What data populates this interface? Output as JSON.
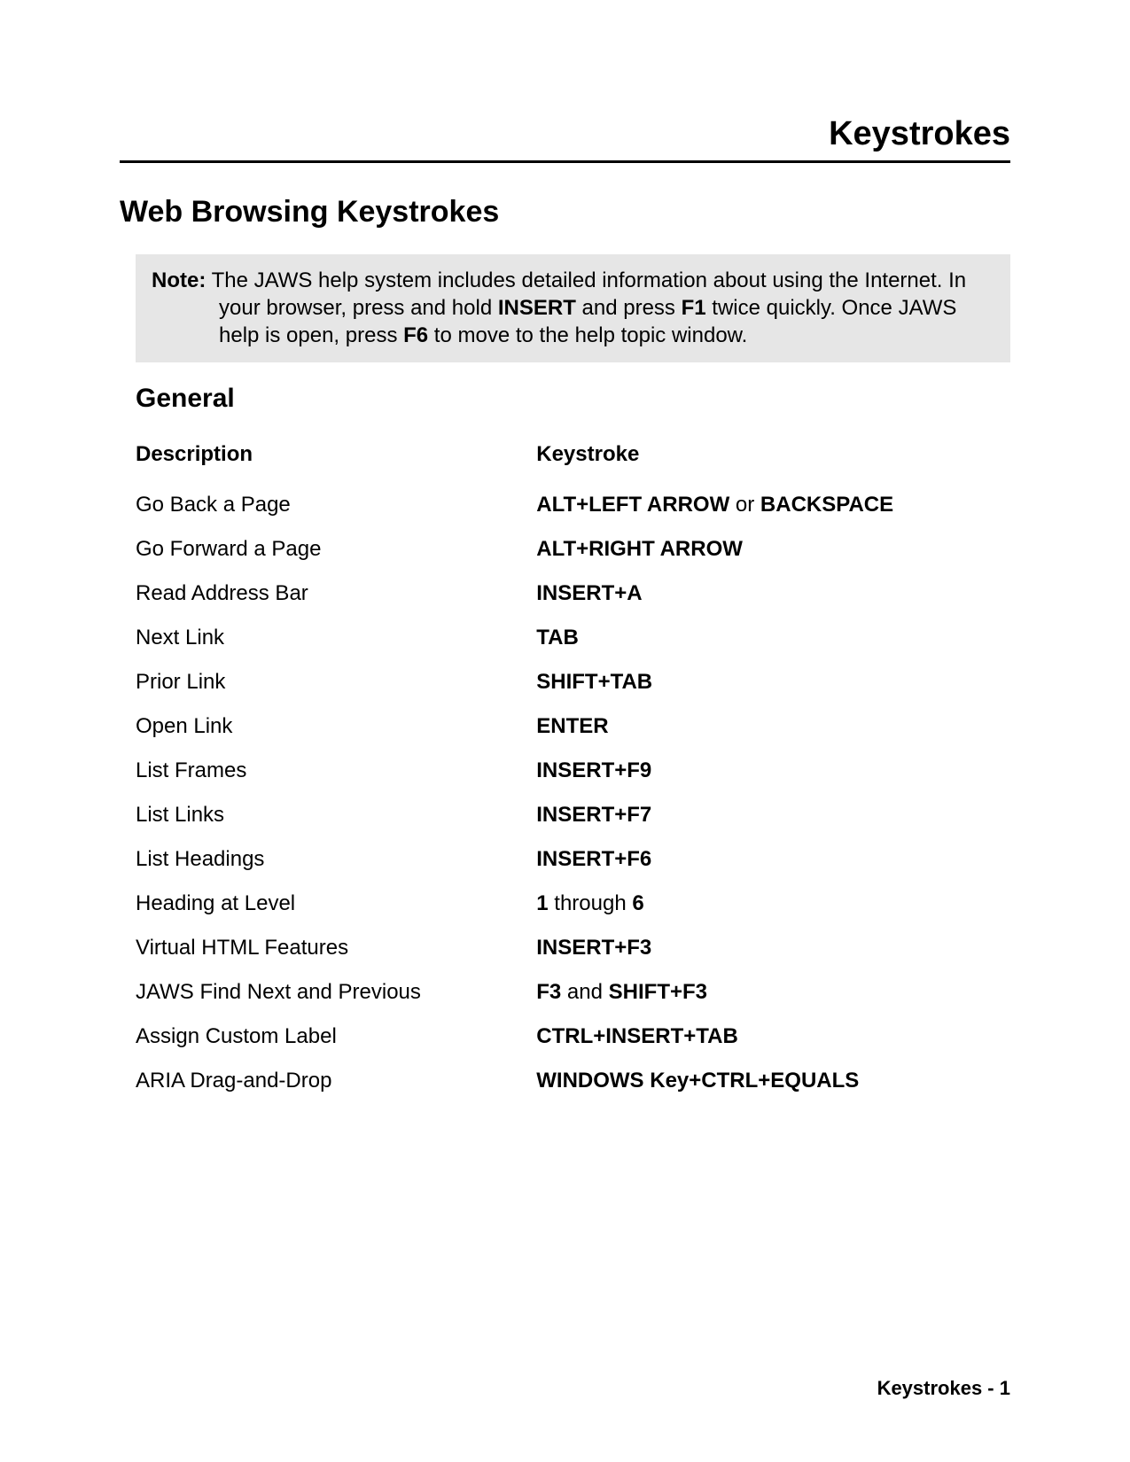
{
  "header": {
    "page_title": "Keystrokes",
    "section_title": "Web Browsing Keystrokes"
  },
  "note": {
    "label": "Note:",
    "seg1": "  The JAWS help system includes detailed information about using the Internet. In your browser, press and hold ",
    "insert": "INSERT",
    "seg2": " and press ",
    "f1": "F1",
    "seg3": " twice quickly. Once JAWS help is open, press ",
    "f6": "F6",
    "seg4": " to move to the help topic window."
  },
  "subsection": {
    "title": "General",
    "col1": "Description",
    "col2": "Keystroke"
  },
  "rows": [
    {
      "desc": "Go Back a Page",
      "k1": "ALT+LEFT ARROW",
      "mid": " or ",
      "k2": "BACKSPACE"
    },
    {
      "desc": "Go Forward a Page",
      "k1": "ALT+RIGHT ARROW"
    },
    {
      "desc": "Read Address Bar",
      "k1": "INSERT+A"
    },
    {
      "desc": "Next Link",
      "k1": "TAB"
    },
    {
      "desc": "Prior Link",
      "k1": "SHIFT+TAB"
    },
    {
      "desc": "Open Link",
      "k1": "ENTER"
    },
    {
      "desc": "List Frames",
      "k1": "INSERT+F9"
    },
    {
      "desc": "List Links",
      "k1": "INSERT+F7"
    },
    {
      "desc": "List Headings",
      "k1": "INSERT+F6"
    },
    {
      "desc": "Heading at Level",
      "k1": "1",
      "mid": " through ",
      "k2": "6"
    },
    {
      "desc": "Virtual HTML Features",
      "k1": "INSERT+F3"
    },
    {
      "desc": "JAWS Find Next and Previous",
      "k1": "F3",
      "mid": " and ",
      "k2": "SHIFT+F3"
    },
    {
      "desc": "Assign Custom Label",
      "k1": "CTRL+INSERT+TAB"
    },
    {
      "desc": "ARIA Drag-and-Drop",
      "k1": "WINDOWS Key+CTRL+EQUALS"
    }
  ],
  "footer": {
    "label": "Keystrokes - ",
    "page": "1"
  }
}
